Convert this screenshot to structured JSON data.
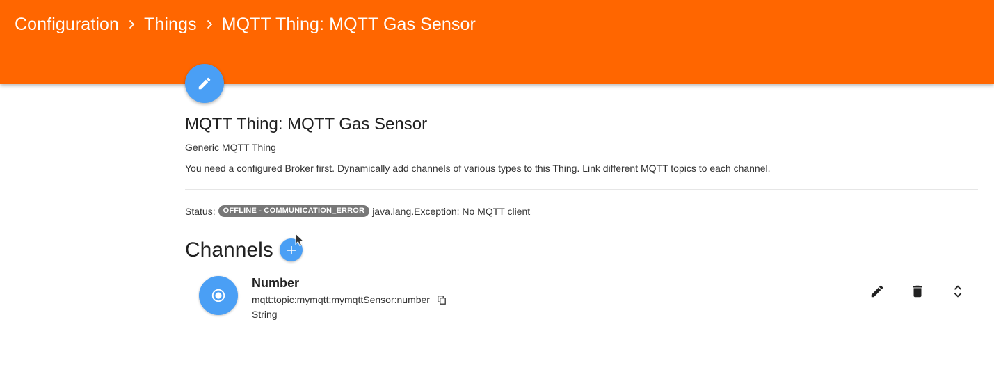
{
  "colors": {
    "header_bg": "#ff6600",
    "accent_blue": "#4a9ff5",
    "status_badge_bg": "#777777"
  },
  "breadcrumb": {
    "items": [
      {
        "label": "Configuration"
      },
      {
        "label": "Things"
      },
      {
        "label": "MQTT Thing: MQTT Gas Sensor"
      }
    ],
    "separator_icon": "chevron-right-icon"
  },
  "thing": {
    "edit_icon": "pencil-icon",
    "title": "MQTT Thing: MQTT Gas Sensor",
    "type_label": "Generic MQTT Thing",
    "description": "You need a configured Broker first. Dynamically add channels of various types to this Thing. Link different MQTT topics to each channel.",
    "status": {
      "label": "Status:",
      "badge": "OFFLINE - COMMUNICATION_ERROR",
      "detail": "java.lang.Exception: No MQTT client"
    }
  },
  "channels": {
    "heading": "Channels",
    "add_icon": "plus-icon",
    "items": [
      {
        "icon": "radio-button-icon",
        "name": "Number",
        "uid": "mqtt:topic:mymqtt:mymqttSensor:number",
        "item_type": "String",
        "actions": [
          "edit-icon",
          "delete-icon",
          "expand-icon"
        ]
      }
    ]
  }
}
